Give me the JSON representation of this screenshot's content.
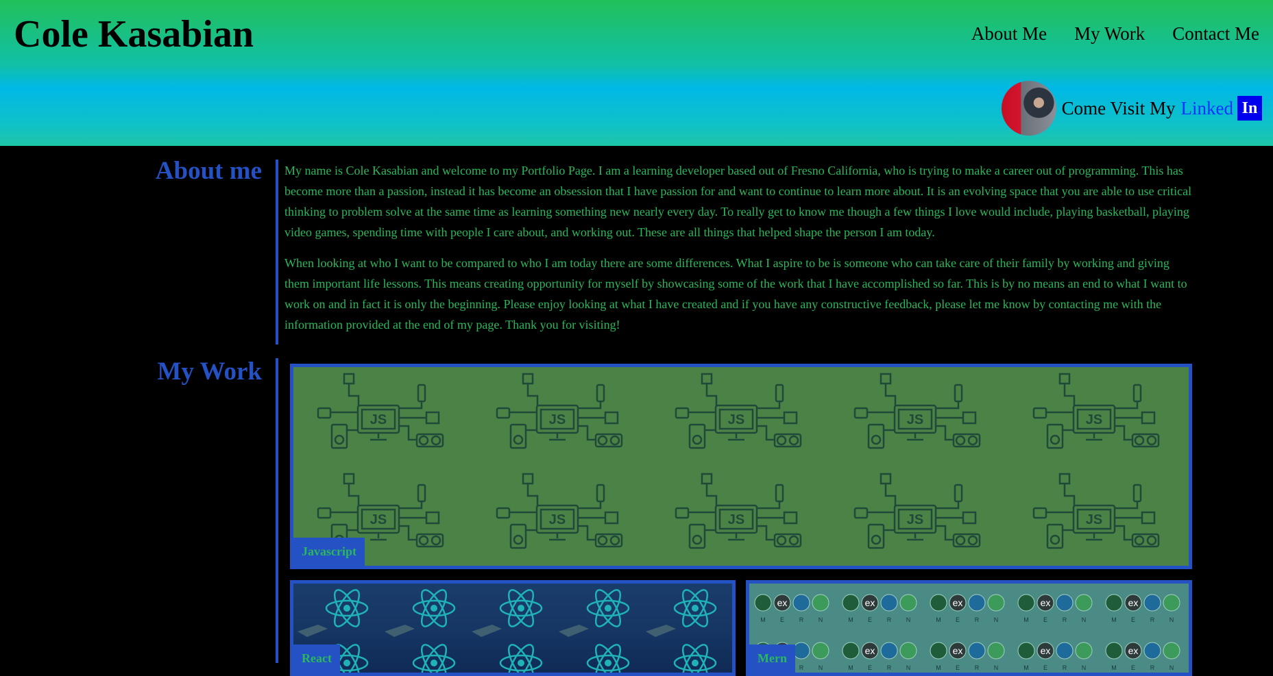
{
  "header": {
    "brand": "Cole Kasabian",
    "nav": [
      "About Me",
      "My Work",
      "Contact Me"
    ],
    "linkedin": {
      "prefix": "Come Visit My",
      "linked": "Linked",
      "badge": "In"
    }
  },
  "about": {
    "title": "About me",
    "paragraphs": [
      "My name is Cole Kasabian and welcome to my Portfolio Page. I am a learning developer based out of Fresno California, who is trying to make a career out of programming. This has become more than a passion, instead it has become an obsession that I have passion for and want to continue to learn more about. It is an evolving space that you are able to use critical thinking to problem solve at the same time as learning something new nearly every day. To really get to know me though a few things I love would include, playing basketball, playing video games, spending time with people I care about, and working out. These are all things that helped shape the person I am today.",
      "When looking at who I want to be compared to who I am today there are some differences. What I aspire to be is someone who can take care of their family by working and giving them important life lessons. This means creating opportunity for myself by showcasing some of the work that I have accomplished so far. This is by no means an end to what I want to work on and in fact it is only the beginning. Please enjoy looking at what I have created and if you have any constructive feedback, please let me know by contacting me with the information provided at the end of my page. Thank you for visiting!"
    ]
  },
  "work": {
    "title": "My Work",
    "projects": [
      {
        "label": "Javascript",
        "pattern_text": "JS"
      },
      {
        "label": "React"
      },
      {
        "label": "Mern",
        "pattern_text": "ex",
        "pattern_letters": [
          "M",
          "E",
          "R",
          "N"
        ]
      }
    ]
  },
  "colors": {
    "accent": "#2451c4",
    "text_green": "#29b85c",
    "js_bg": "#4b8246",
    "mern_bg": "#4b8b86",
    "react_bg": "#163563",
    "linkedin_blue": "#0033ff"
  }
}
